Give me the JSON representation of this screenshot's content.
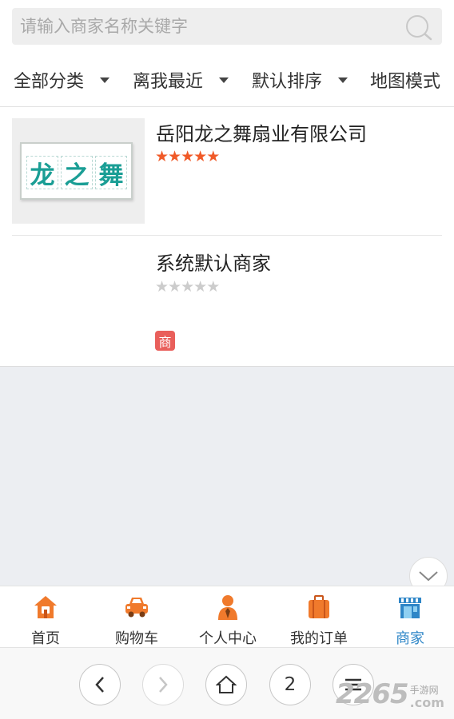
{
  "search": {
    "placeholder": "请输入商家名称关键字",
    "icon": "search-icon"
  },
  "filters": [
    {
      "label": "全部分类",
      "has_dropdown": true
    },
    {
      "label": "离我最近",
      "has_dropdown": true
    },
    {
      "label": "默认排序",
      "has_dropdown": true
    },
    {
      "label": "地图模式",
      "has_dropdown": false
    }
  ],
  "stores": [
    {
      "name": "岳阳龙之舞扇业有限公司",
      "rating": 5,
      "rating_max": 5,
      "logo_text": [
        "龙",
        "之",
        "舞"
      ],
      "badge": ""
    },
    {
      "name": "系统默认商家",
      "rating": 0,
      "rating_max": 5,
      "badge": "商"
    }
  ],
  "collapse_icon": "chevron-down-icon",
  "tabbar": [
    {
      "label": "首页",
      "icon": "home-icon",
      "active": false
    },
    {
      "label": "购物车",
      "icon": "car-icon",
      "active": false
    },
    {
      "label": "个人中心",
      "icon": "person-icon",
      "active": false
    },
    {
      "label": "我的订单",
      "icon": "briefcase-icon",
      "active": false
    },
    {
      "label": "商家",
      "icon": "store-icon",
      "active": true
    }
  ],
  "browser": {
    "tab_count": "2"
  },
  "watermark": {
    "number": "2265",
    "site_cn": "手游网",
    "suffix": ".com"
  },
  "colors": {
    "star_filled": "#f05a28",
    "star_empty": "#cccccc",
    "active_tab": "#2e86c7",
    "badge": "#e95f5b",
    "icon_orange": "#f07a2c"
  }
}
